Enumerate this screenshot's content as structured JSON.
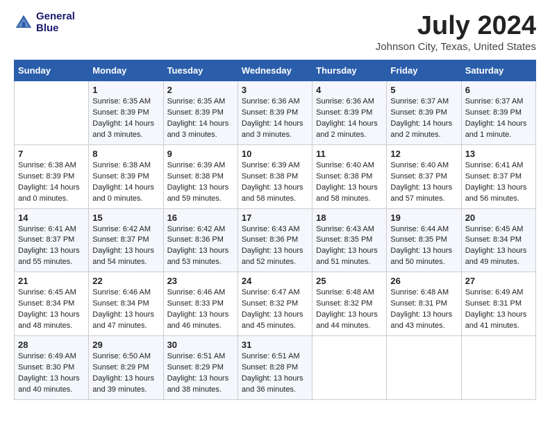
{
  "header": {
    "logo_line1": "General",
    "logo_line2": "Blue",
    "month_title": "July 2024",
    "location": "Johnson City, Texas, United States"
  },
  "days_of_week": [
    "Sunday",
    "Monday",
    "Tuesday",
    "Wednesday",
    "Thursday",
    "Friday",
    "Saturday"
  ],
  "weeks": [
    [
      {
        "day": "",
        "info": ""
      },
      {
        "day": "1",
        "info": "Sunrise: 6:35 AM\nSunset: 8:39 PM\nDaylight: 14 hours\nand 3 minutes."
      },
      {
        "day": "2",
        "info": "Sunrise: 6:35 AM\nSunset: 8:39 PM\nDaylight: 14 hours\nand 3 minutes."
      },
      {
        "day": "3",
        "info": "Sunrise: 6:36 AM\nSunset: 8:39 PM\nDaylight: 14 hours\nand 3 minutes."
      },
      {
        "day": "4",
        "info": "Sunrise: 6:36 AM\nSunset: 8:39 PM\nDaylight: 14 hours\nand 2 minutes."
      },
      {
        "day": "5",
        "info": "Sunrise: 6:37 AM\nSunset: 8:39 PM\nDaylight: 14 hours\nand 2 minutes."
      },
      {
        "day": "6",
        "info": "Sunrise: 6:37 AM\nSunset: 8:39 PM\nDaylight: 14 hours\nand 1 minute."
      }
    ],
    [
      {
        "day": "7",
        "info": "Sunrise: 6:38 AM\nSunset: 8:39 PM\nDaylight: 14 hours\nand 0 minutes."
      },
      {
        "day": "8",
        "info": "Sunrise: 6:38 AM\nSunset: 8:39 PM\nDaylight: 14 hours\nand 0 minutes."
      },
      {
        "day": "9",
        "info": "Sunrise: 6:39 AM\nSunset: 8:38 PM\nDaylight: 13 hours\nand 59 minutes."
      },
      {
        "day": "10",
        "info": "Sunrise: 6:39 AM\nSunset: 8:38 PM\nDaylight: 13 hours\nand 58 minutes."
      },
      {
        "day": "11",
        "info": "Sunrise: 6:40 AM\nSunset: 8:38 PM\nDaylight: 13 hours\nand 58 minutes."
      },
      {
        "day": "12",
        "info": "Sunrise: 6:40 AM\nSunset: 8:37 PM\nDaylight: 13 hours\nand 57 minutes."
      },
      {
        "day": "13",
        "info": "Sunrise: 6:41 AM\nSunset: 8:37 PM\nDaylight: 13 hours\nand 56 minutes."
      }
    ],
    [
      {
        "day": "14",
        "info": "Sunrise: 6:41 AM\nSunset: 8:37 PM\nDaylight: 13 hours\nand 55 minutes."
      },
      {
        "day": "15",
        "info": "Sunrise: 6:42 AM\nSunset: 8:37 PM\nDaylight: 13 hours\nand 54 minutes."
      },
      {
        "day": "16",
        "info": "Sunrise: 6:42 AM\nSunset: 8:36 PM\nDaylight: 13 hours\nand 53 minutes."
      },
      {
        "day": "17",
        "info": "Sunrise: 6:43 AM\nSunset: 8:36 PM\nDaylight: 13 hours\nand 52 minutes."
      },
      {
        "day": "18",
        "info": "Sunrise: 6:43 AM\nSunset: 8:35 PM\nDaylight: 13 hours\nand 51 minutes."
      },
      {
        "day": "19",
        "info": "Sunrise: 6:44 AM\nSunset: 8:35 PM\nDaylight: 13 hours\nand 50 minutes."
      },
      {
        "day": "20",
        "info": "Sunrise: 6:45 AM\nSunset: 8:34 PM\nDaylight: 13 hours\nand 49 minutes."
      }
    ],
    [
      {
        "day": "21",
        "info": "Sunrise: 6:45 AM\nSunset: 8:34 PM\nDaylight: 13 hours\nand 48 minutes."
      },
      {
        "day": "22",
        "info": "Sunrise: 6:46 AM\nSunset: 8:34 PM\nDaylight: 13 hours\nand 47 minutes."
      },
      {
        "day": "23",
        "info": "Sunrise: 6:46 AM\nSunset: 8:33 PM\nDaylight: 13 hours\nand 46 minutes."
      },
      {
        "day": "24",
        "info": "Sunrise: 6:47 AM\nSunset: 8:32 PM\nDaylight: 13 hours\nand 45 minutes."
      },
      {
        "day": "25",
        "info": "Sunrise: 6:48 AM\nSunset: 8:32 PM\nDaylight: 13 hours\nand 44 minutes."
      },
      {
        "day": "26",
        "info": "Sunrise: 6:48 AM\nSunset: 8:31 PM\nDaylight: 13 hours\nand 43 minutes."
      },
      {
        "day": "27",
        "info": "Sunrise: 6:49 AM\nSunset: 8:31 PM\nDaylight: 13 hours\nand 41 minutes."
      }
    ],
    [
      {
        "day": "28",
        "info": "Sunrise: 6:49 AM\nSunset: 8:30 PM\nDaylight: 13 hours\nand 40 minutes."
      },
      {
        "day": "29",
        "info": "Sunrise: 6:50 AM\nSunset: 8:29 PM\nDaylight: 13 hours\nand 39 minutes."
      },
      {
        "day": "30",
        "info": "Sunrise: 6:51 AM\nSunset: 8:29 PM\nDaylight: 13 hours\nand 38 minutes."
      },
      {
        "day": "31",
        "info": "Sunrise: 6:51 AM\nSunset: 8:28 PM\nDaylight: 13 hours\nand 36 minutes."
      },
      {
        "day": "",
        "info": ""
      },
      {
        "day": "",
        "info": ""
      },
      {
        "day": "",
        "info": ""
      }
    ]
  ]
}
